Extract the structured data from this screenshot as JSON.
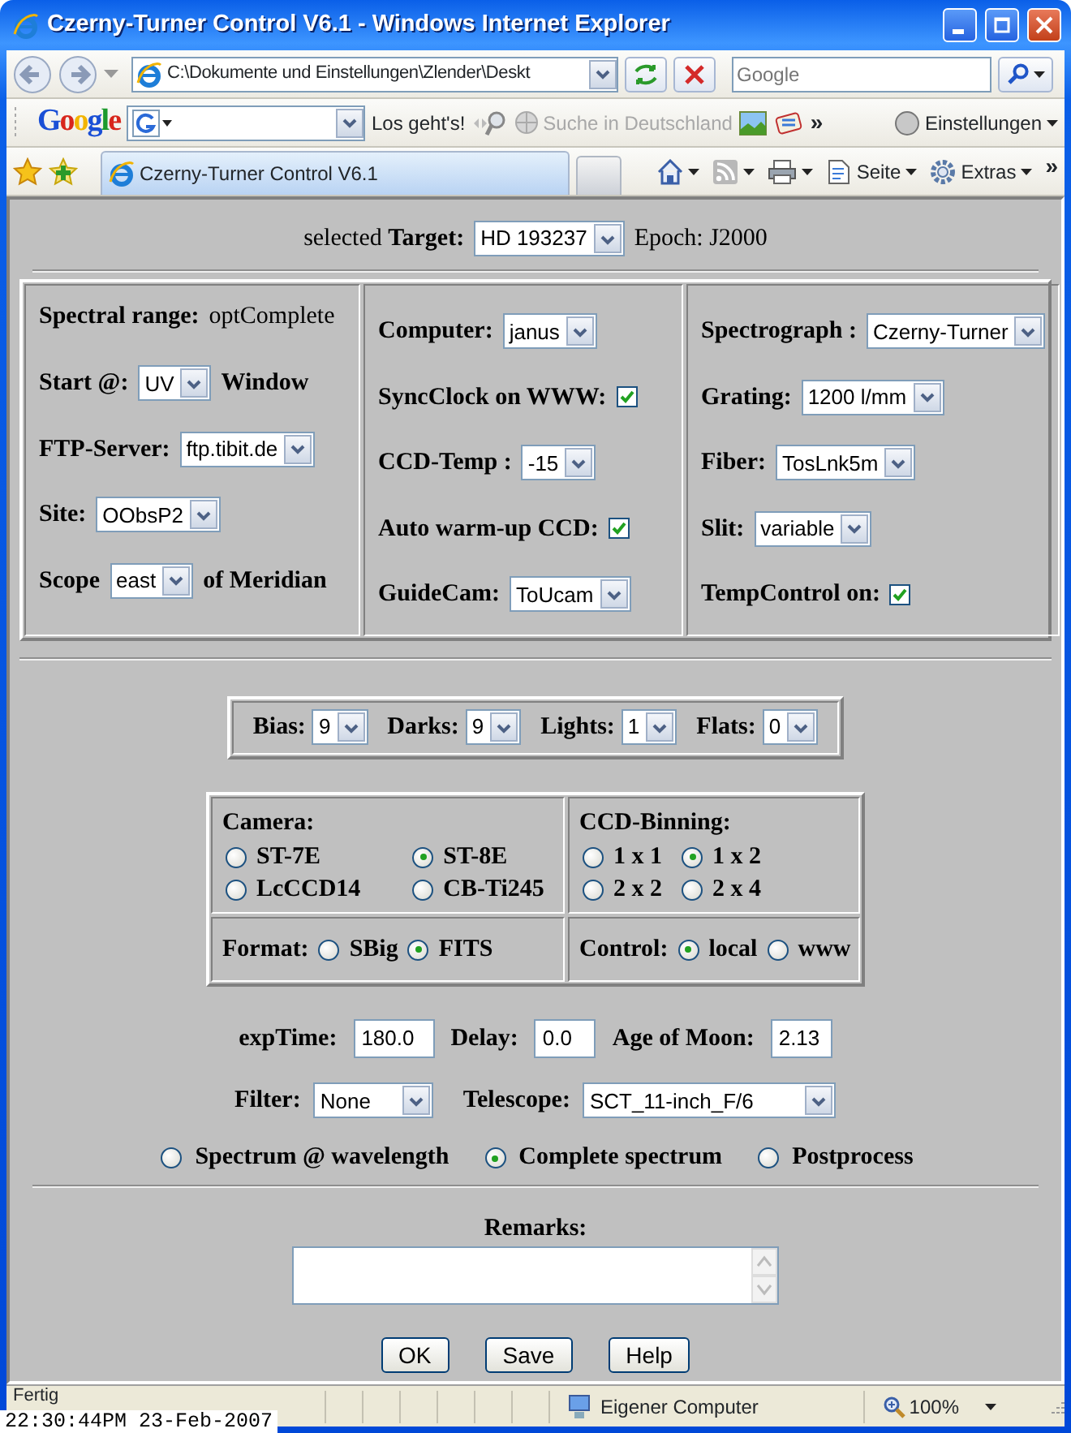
{
  "window": {
    "title": "Czerny-Turner Control V6.1 - Windows Internet Explorer"
  },
  "address_bar": {
    "url": "C:\\Dokumente und Einstellungen\\Zlender\\Deskt",
    "search": {
      "placeholder": "Google"
    }
  },
  "google_toolbar": {
    "brand": "Google",
    "go_button": "Los geht's!",
    "search_link": "Suche in Deutschland",
    "more": "»",
    "settings": "Einstellungen"
  },
  "tab_bar": {
    "tab": "Czerny-Turner Control V6.1",
    "commands": [
      "Seite",
      "Extras"
    ],
    "more": "»"
  },
  "target": {
    "label": "selected **Target:**",
    "value": "HD 193237",
    "epoch": "Epoch: J2000"
  },
  "panel": [
    {
      "fields": [
        {
          "kind": "static",
          "label": "Spectral range:",
          "value": "optComplete"
        },
        {
          "kind": "select",
          "label": "Start @:",
          "value": "UV",
          "suffix": "Window"
        },
        {
          "kind": "select",
          "label": "FTP-Server:",
          "value": "ftp.tibit.de"
        },
        {
          "kind": "select",
          "label": "Site:",
          "value": "OObsP2"
        },
        {
          "kind": "select",
          "label": "Scope",
          "value": "east",
          "suffix": "of Meridian"
        }
      ]
    },
    {
      "fields": [
        {
          "kind": "select",
          "label": "Computer:",
          "value": "janus"
        },
        {
          "kind": "checkbox",
          "label": "SyncClock on WWW:",
          "checked": true
        },
        {
          "kind": "select",
          "label": "CCD-Temp :",
          "value": "-15"
        },
        {
          "kind": "checkbox",
          "label": "Auto warm-up CCD:",
          "checked": true
        },
        {
          "kind": "select",
          "label": "GuideCam:",
          "value": "ToUcam"
        }
      ]
    },
    {
      "fields": [
        {
          "kind": "select",
          "label": "Spectrograph :",
          "value": "Czerny-Turner"
        },
        {
          "kind": "select",
          "label": "Grating:",
          "value": "1200 l/mm"
        },
        {
          "kind": "select",
          "label": "Fiber:",
          "value": "TosLnk5m"
        },
        {
          "kind": "select",
          "label": "Slit:",
          "value": "variable"
        },
        {
          "kind": "checkbox",
          "label": "TempControl on:",
          "checked": true
        }
      ]
    }
  ],
  "frame_counts": [
    {
      "label": "Bias:",
      "value": "9"
    },
    {
      "label": "Darks:",
      "value": "9"
    },
    {
      "label": "Lights:",
      "value": "1"
    },
    {
      "label": "Flats:",
      "value": "0"
    }
  ],
  "camera_table": [
    {
      "kind": "grid",
      "label": "Camera:",
      "options": [
        {
          "label": "ST-7E",
          "selected": false
        },
        {
          "label": "ST-8E",
          "selected": true
        },
        {
          "label": "LcCCD14",
          "selected": false
        },
        {
          "label": "CB-Ti245",
          "selected": false
        }
      ]
    },
    {
      "kind": "grid",
      "label": "CCD-Binning:",
      "options": [
        {
          "label": "1 x 1",
          "selected": false
        },
        {
          "label": "1 x 2",
          "selected": true
        },
        {
          "label": "2 x 2",
          "selected": false
        },
        {
          "label": "2 x 4",
          "selected": false
        }
      ]
    },
    {
      "kind": "inline",
      "label": "Format:",
      "options": [
        {
          "label": "SBig",
          "selected": false
        },
        {
          "label": "FITS",
          "selected": true
        }
      ]
    },
    {
      "kind": "inline",
      "label": "Control:",
      "options": [
        {
          "label": "local",
          "selected": true
        },
        {
          "label": "www",
          "selected": false
        }
      ]
    }
  ],
  "exposure": [
    {
      "label": "expTime:",
      "value": "180.0"
    },
    {
      "label": "Delay:",
      "value": "0.0"
    },
    {
      "label": "Age of Moon:",
      "value": "2.13"
    }
  ],
  "optics": [
    {
      "label": "Filter:",
      "value": "None"
    },
    {
      "label": "Telescope:",
      "value": "SCT_11-inch_F/6"
    }
  ],
  "mode": [
    {
      "label": "Spectrum @ wavelength",
      "selected": false
    },
    {
      "label": "Complete spectrum",
      "selected": true
    },
    {
      "label": "Postprocess",
      "selected": false
    }
  ],
  "remarks": {
    "label": "Remarks:"
  },
  "buttons": [
    "OK",
    "Save",
    "Help"
  ],
  "status_bar": {
    "text": "Fertig",
    "zone": "Eigener Computer",
    "zoom": "100%"
  },
  "timestamp": "22:30:44PM 23-Feb-2007"
}
